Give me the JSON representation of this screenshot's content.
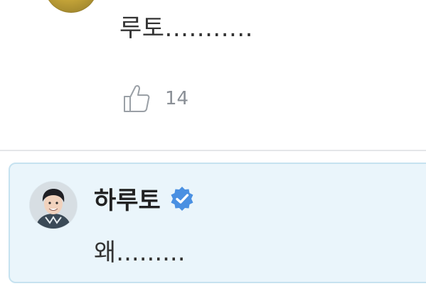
{
  "top_comment": {
    "text": "루토...........",
    "like_count": "14",
    "avatar_icon": "avatar-image-yellow"
  },
  "reply": {
    "author": "하루토",
    "verified_icon": "verified-badge-icon",
    "text": "왜.........",
    "avatar_icon": "avatar-image-person"
  },
  "colors": {
    "reply_background": "#eaf5fb",
    "reply_border": "#c6e2f0",
    "verified_blue": "#4a90e2",
    "muted_gray": "#8a8f96"
  }
}
